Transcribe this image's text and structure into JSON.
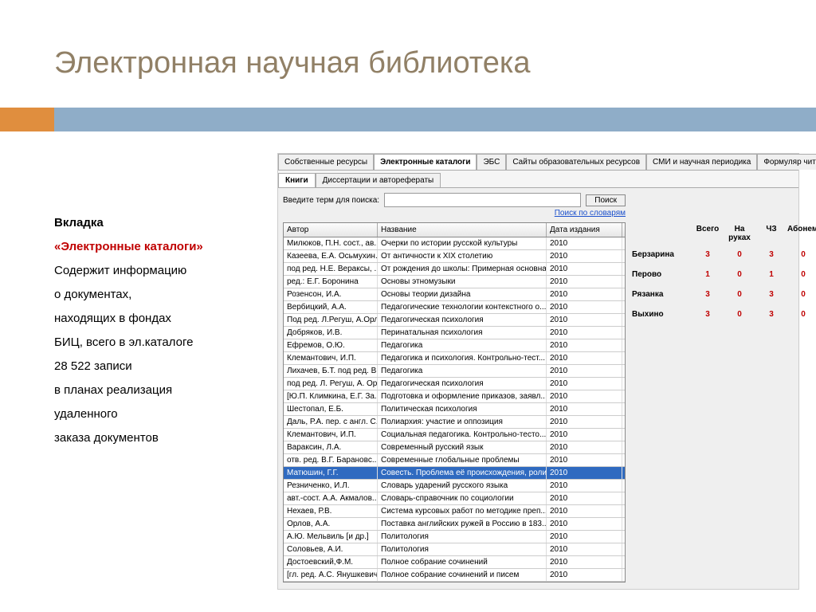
{
  "title": "Электронная научная библиотека",
  "description": {
    "l1a": "Вкладка",
    "l1b": "«Электронные каталоги»",
    "l2": "Содержит информацию",
    "l3": "о документах,",
    "l4": "находящих в фондах",
    "l5": "БИЦ, всего в эл.каталоге",
    "l6": " 28 522 записи",
    "l7": "в планах реализация",
    "l8": "удаленного",
    "l9": "заказа документов"
  },
  "tabs1": [
    "Собственные ресурсы",
    "Электронные каталоги",
    "ЭБС",
    "Сайты образовательных ресурсов",
    "СМИ и научная периодика",
    "Формуляр читателя"
  ],
  "tabs1_active": 1,
  "tabs2": [
    "Книги",
    "Диссертации и авторефераты"
  ],
  "tabs2_active": 0,
  "search": {
    "label": "Введите терм для поиска:",
    "value": "",
    "button": "Поиск",
    "dict": "Поиск по словарям"
  },
  "grid": {
    "cols": [
      "Автор",
      "Название",
      "Дата издания"
    ],
    "rows": [
      {
        "a": "Милюков, П.Н. сост., ав...",
        "t": "Очерки по истории русской культуры",
        "d": "2010"
      },
      {
        "a": "Казеева, Е.А. Осьмухин...",
        "t": "От античности к XIX столетию",
        "d": "2010"
      },
      {
        "a": "под ред. Н.Е. Вераксы, ...",
        "t": "От рождения до школы: Примерная основна...",
        "d": "2010"
      },
      {
        "a": "ред.: Е.Г. Боронина",
        "t": "Основы этномузыки",
        "d": "2010"
      },
      {
        "a": "Розенсон, И.А.",
        "t": "Основы теории дизайна",
        "d": "2010"
      },
      {
        "a": "Вербицкий, А.А.",
        "t": "Педагогические технологии контекстного о...",
        "d": "2010"
      },
      {
        "a": "Под ред. Л.Регуш, А.Орл...",
        "t": "Педагогическая психология",
        "d": "2010"
      },
      {
        "a": "Добряков, И.В.",
        "t": "Перинатальная психология",
        "d": "2010"
      },
      {
        "a": "Ефремов, О.Ю.",
        "t": "Педагогика",
        "d": "2010"
      },
      {
        "a": "Клемантович, И.П.",
        "t": "Педагогика  и психология. Контрольно-тест...",
        "d": "2010"
      },
      {
        "a": "Лихачев, Б.Т. под ред. В...",
        "t": "Педагогика",
        "d": "2010"
      },
      {
        "a": "под ред. Л. Регуш, А. Ор...",
        "t": "Педагогическая психология",
        "d": "2010"
      },
      {
        "a": "[Ю.П. Климкина, Е.Г. За...",
        "t": "Подготовка и оформление приказов, заявл...",
        "d": "2010"
      },
      {
        "a": "Шестопал, Е.Б.",
        "t": "Политическая психология",
        "d": "2010"
      },
      {
        "a": "Даль, Р.А. пер. с англ. С....",
        "t": "Полиархия: участие и оппозиция",
        "d": "2010"
      },
      {
        "a": "Клемантович, И.П.",
        "t": "Социальная педагогика. Контрольно-тесто...",
        "d": "2010"
      },
      {
        "a": "Вараксин, Л.А.",
        "t": "Современный русский язык",
        "d": "2010"
      },
      {
        "a": "отв. ред. В.Г. Барановс...",
        "t": "Современные глобальные проблемы",
        "d": "2010"
      },
      {
        "a": "Матюшин, Г.Г.",
        "t": "Совесть. Проблема её происхождения, роли...",
        "d": "2010",
        "sel": true
      },
      {
        "a": "Резниченко, И.Л.",
        "t": "Словарь ударений русского языка",
        "d": "2010"
      },
      {
        "a": "авт.-сост. А.А. Акмалов...",
        "t": "Словарь-справочник по социологии",
        "d": "2010"
      },
      {
        "a": "Нехаев, Р.В.",
        "t": "Система курсовых работ по методике преп...",
        "d": "2010"
      },
      {
        "a": "Орлов, А.А.",
        "t": "Поставка английских ружей в Россию в 183...",
        "d": "2010"
      },
      {
        "a": "А.Ю. Мельвиль [и др.]",
        "t": "Политология",
        "d": "2010"
      },
      {
        "a": "Соловьев, А.И.",
        "t": "Политология",
        "d": "2010"
      },
      {
        "a": "Достоевский,Ф.М.",
        "t": "Полное собрание сочинений",
        "d": "2010"
      },
      {
        "a": "[гл. ред. А.С. Янушкевич...",
        "t": "Полное собрание сочинений и писем",
        "d": "2010"
      }
    ]
  },
  "stats": {
    "cols": [
      "Всего",
      "На руках",
      "ЧЗ",
      "Абонемент"
    ],
    "rows": [
      {
        "name": "Берзарина",
        "v": [
          "3",
          "0",
          "3",
          "0"
        ]
      },
      {
        "name": "Перово",
        "v": [
          "1",
          "0",
          "1",
          "0"
        ]
      },
      {
        "name": "Рязанка",
        "v": [
          "3",
          "0",
          "3",
          "0"
        ]
      },
      {
        "name": "Выхино",
        "v": [
          "3",
          "0",
          "3",
          "0"
        ]
      }
    ]
  }
}
